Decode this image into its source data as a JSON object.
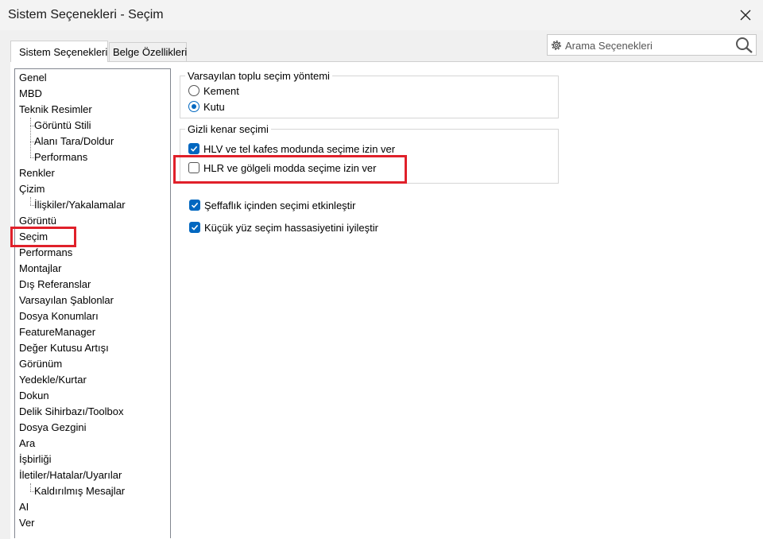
{
  "window": {
    "title": "Sistem Seçenekleri - Seçim"
  },
  "tabs": [
    {
      "label": "Sistem Seçenekleri"
    },
    {
      "label": "Belge Özellikleri"
    }
  ],
  "search": {
    "placeholder": "Arama Seçenekleri"
  },
  "tree": {
    "items": [
      {
        "label": "Genel",
        "indent": 0
      },
      {
        "label": "MBD",
        "indent": 0
      },
      {
        "label": "Teknik Resimler",
        "indent": 0
      },
      {
        "label": "Görüntü Stili",
        "indent": 1
      },
      {
        "label": "Alanı Tara/Doldur",
        "indent": 1
      },
      {
        "label": "Performans",
        "indent": 1
      },
      {
        "label": "Renkler",
        "indent": 0
      },
      {
        "label": "Çizim",
        "indent": 0
      },
      {
        "label": "İlişkiler/Yakalamalar",
        "indent": 1
      },
      {
        "label": "Görüntü",
        "indent": 0
      },
      {
        "label": "Seçim",
        "indent": 0,
        "selected": true
      },
      {
        "label": "Performans",
        "indent": 0
      },
      {
        "label": "Montajlar",
        "indent": 0
      },
      {
        "label": "Dış Referanslar",
        "indent": 0
      },
      {
        "label": "Varsayılan Şablonlar",
        "indent": 0
      },
      {
        "label": "Dosya Konumları",
        "indent": 0
      },
      {
        "label": "FeatureManager",
        "indent": 0
      },
      {
        "label": "Değer Kutusu Artışı",
        "indent": 0
      },
      {
        "label": "Görünüm",
        "indent": 0
      },
      {
        "label": "Yedekle/Kurtar",
        "indent": 0
      },
      {
        "label": "Dokun",
        "indent": 0
      },
      {
        "label": "Delik Sihirbazı/Toolbox",
        "indent": 0
      },
      {
        "label": "Dosya Gezgini",
        "indent": 0
      },
      {
        "label": "Ara",
        "indent": 0
      },
      {
        "label": "İşbirliği",
        "indent": 0
      },
      {
        "label": "İletiler/Hatalar/Uyarılar",
        "indent": 0
      },
      {
        "label": "Kaldırılmış Mesajlar",
        "indent": 1
      },
      {
        "label": "AI",
        "indent": 0
      },
      {
        "label": "Ver",
        "indent": 0
      }
    ]
  },
  "selection_method": {
    "title": "Varsayılan toplu seçim yöntemi",
    "options": [
      {
        "label": "Kement",
        "selected": false
      },
      {
        "label": "Kutu",
        "selected": true
      }
    ]
  },
  "hidden_edges": {
    "title": "Gizli kenar seçimi",
    "options": [
      {
        "label": "HLV ve tel kafes modunda seçime izin ver",
        "checked": true
      },
      {
        "label": "HLR ve gölgeli modda seçime izin ver",
        "checked": false
      }
    ]
  },
  "misc_options": [
    {
      "label": "Şeffaflık içinden seçimi etkinleştir",
      "checked": true
    },
    {
      "label": "Küçük yüz seçim hassasiyetini iyileştir",
      "checked": true
    }
  ],
  "colors": {
    "accent": "#0067c0",
    "highlight": "#e0202a"
  }
}
